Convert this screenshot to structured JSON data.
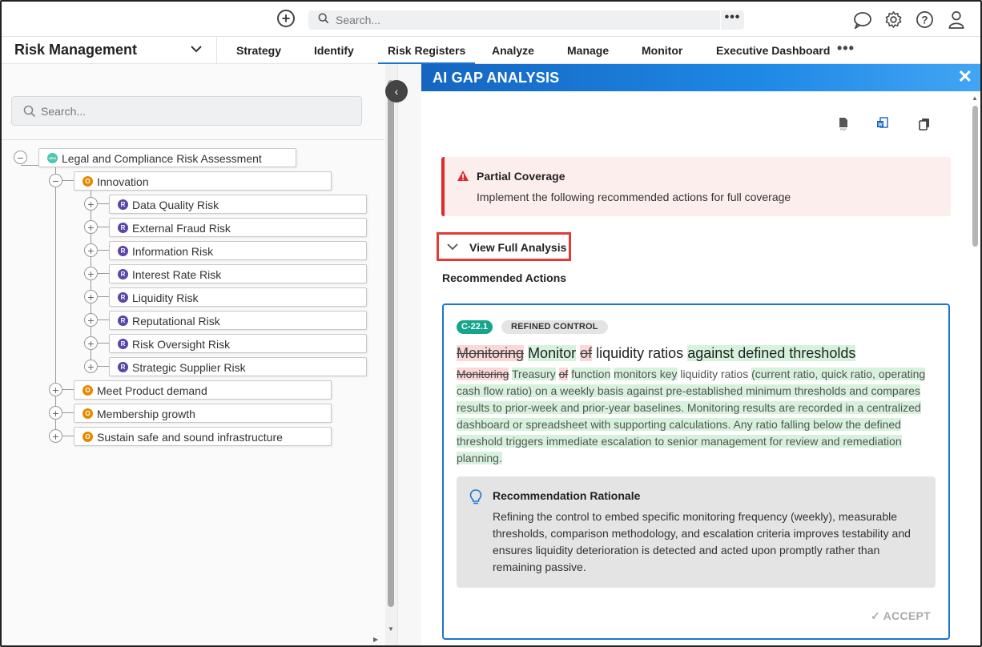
{
  "topbar": {
    "search_placeholder": "Search...",
    "more_label": "•••"
  },
  "navbar": {
    "module": "Risk Management",
    "tabs": [
      {
        "label": "Strategy"
      },
      {
        "label": "Identify"
      },
      {
        "label": "Risk Registers",
        "active": true
      },
      {
        "label": "Analyze"
      },
      {
        "label": "Manage"
      },
      {
        "label": "Monitor"
      },
      {
        "label": "Executive Dashboard"
      }
    ],
    "more_label": "•••"
  },
  "sidebar": {
    "search_placeholder": "Search...",
    "tree": {
      "root": {
        "label": "Legal and Compliance Risk Assessment",
        "badge": "ORG"
      },
      "objectives": [
        {
          "label": "Innovation",
          "badge": "O",
          "expanded": true,
          "risks": [
            {
              "label": "Data Quality Risk",
              "badge": "R"
            },
            {
              "label": "External Fraud Risk",
              "badge": "R"
            },
            {
              "label": "Information Risk",
              "badge": "R"
            },
            {
              "label": "Interest Rate Risk",
              "badge": "R"
            },
            {
              "label": "Liquidity Risk",
              "badge": "R"
            },
            {
              "label": "Reputational Risk",
              "badge": "R"
            },
            {
              "label": "Risk Oversight Risk",
              "badge": "R"
            },
            {
              "label": "Strategic Supplier Risk",
              "badge": "R"
            }
          ]
        },
        {
          "label": "Meet Product demand",
          "badge": "O"
        },
        {
          "label": "Membership growth",
          "badge": "O"
        },
        {
          "label": "Sustain safe and sound infrastructure",
          "badge": "O"
        }
      ]
    }
  },
  "panel": {
    "title": "AI GAP ANALYSIS",
    "alert": {
      "title": "Partial Coverage",
      "message": "Implement the following recommended actions for full coverage"
    },
    "view_full_label": "View Full Analysis",
    "recommended_title": "Recommended Actions",
    "card": {
      "control_id": "C-22.1",
      "control_type": "REFINED CONTROL",
      "title_parts": [
        {
          "text": "Monitoring",
          "kind": "del"
        },
        {
          "text": " ",
          "kind": "plain"
        },
        {
          "text": "Monitor",
          "kind": "ins"
        },
        {
          "text": " ",
          "kind": "plain"
        },
        {
          "text": "of",
          "kind": "del"
        },
        {
          "text": " liquidity ratios ",
          "kind": "plain"
        },
        {
          "text": "against defined thresholds",
          "kind": "ins"
        }
      ],
      "desc_parts": [
        {
          "text": "Monitoring",
          "kind": "del"
        },
        {
          "text": " ",
          "kind": "plain"
        },
        {
          "text": "Treasury",
          "kind": "ins"
        },
        {
          "text": " ",
          "kind": "plain"
        },
        {
          "text": "of",
          "kind": "del"
        },
        {
          "text": " ",
          "kind": "plain"
        },
        {
          "text": "function",
          "kind": "ins"
        },
        {
          "text": " ",
          "kind": "plain"
        },
        {
          "text": "monitors key",
          "kind": "ins"
        },
        {
          "text": " liquidity ratios ",
          "kind": "plain"
        },
        {
          "text": "(current ratio, quick ratio, operating cash flow ratio) on a weekly basis against pre-established minimum thresholds and compares results to prior-week and prior-year baselines. Monitoring results are recorded in a centralized dashboard or spreadsheet with supporting calculations. Any ratio falling below the defined threshold triggers immediate escalation to senior management for review and remediation planning.",
          "kind": "ins"
        }
      ],
      "rationale_title": "Recommendation Rationale",
      "rationale_text": "Refining the control to embed specific monitoring frequency (weekly), measurable thresholds, comparison methodology, and escalation criteria improves testability and ensures liquidity deterioration is detected and acted upon promptly rather than remaining passive.",
      "accept_label": "ACCEPT"
    }
  }
}
